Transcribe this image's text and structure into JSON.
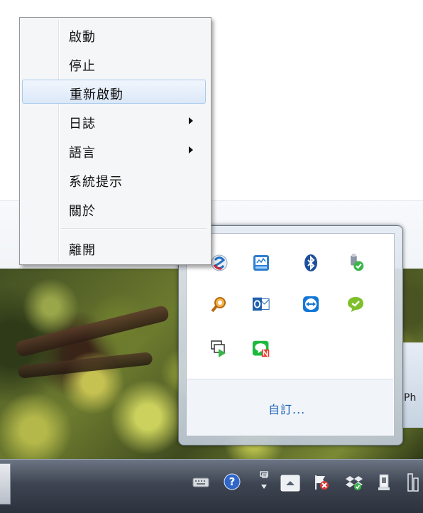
{
  "context_menu": {
    "items": [
      {
        "label": "啟動",
        "has_submenu": false,
        "highlighted": false
      },
      {
        "label": "停止",
        "has_submenu": false,
        "highlighted": false
      },
      {
        "label": "重新啟動",
        "has_submenu": false,
        "highlighted": true
      },
      {
        "label": "日誌",
        "has_submenu": true,
        "highlighted": false
      },
      {
        "label": "語言",
        "has_submenu": true,
        "highlighted": false
      },
      {
        "label": "系統提示",
        "has_submenu": false,
        "highlighted": false
      },
      {
        "label": "關於",
        "has_submenu": false,
        "highlighted": false
      },
      {
        "label": "離開",
        "has_submenu": false,
        "highlighted": false
      }
    ]
  },
  "tray_overflow": {
    "icons": [
      "app-swirl-icon",
      "network-monitor-icon",
      "bluetooth-icon",
      "usb-device-ok-icon",
      "key-search-icon",
      "outlook-icon",
      "teamviewer-icon",
      "chat-green-icon",
      "remote-desktop-icon",
      "line-messenger-icon"
    ],
    "customize_label": "自訂..."
  },
  "desktop": {
    "side_window_label": "Ph"
  },
  "taskbar": {
    "tray_icons": [
      "keyboard-icon",
      "help-icon",
      "network-icon",
      "show-hidden-icons-button",
      "action-center-flag-icon",
      "dropbox-icon",
      "safely-remove-hardware-icon",
      "network-status-icon"
    ]
  },
  "colors": {
    "menu_highlight": "#dbe8f8",
    "link": "#1a5fb4",
    "accent_green": "#3bb54a",
    "accent_red": "#d63a3a"
  }
}
